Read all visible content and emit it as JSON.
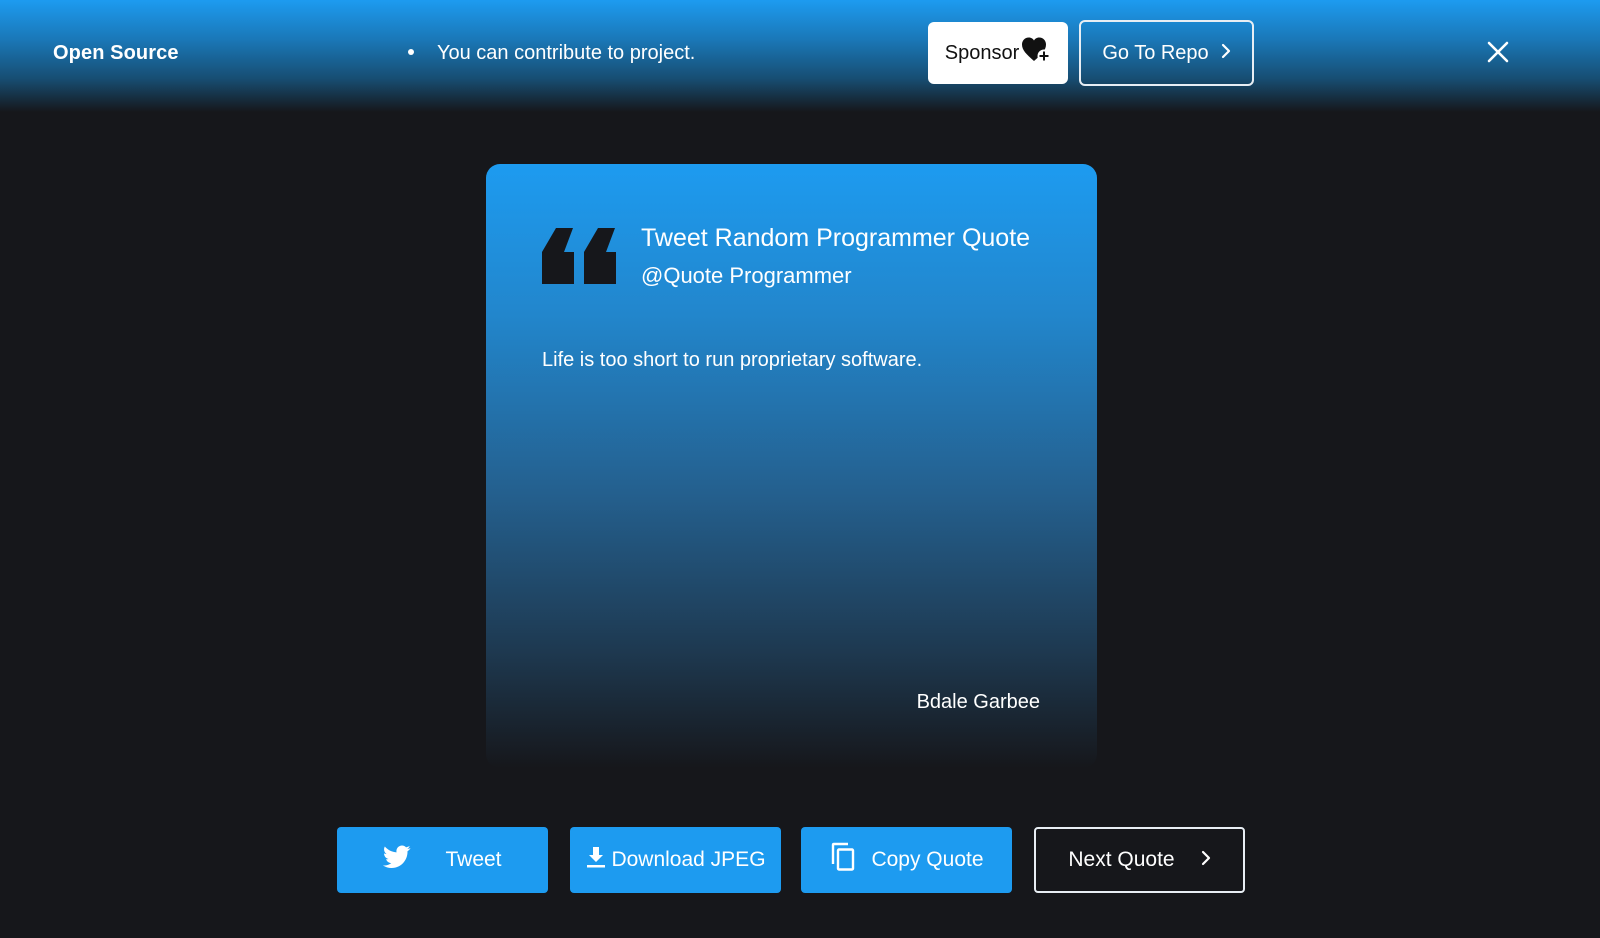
{
  "banner": {
    "title": "Open Source",
    "message": "You can contribute to project.",
    "sponsor_label": "Sponsor",
    "repo_label": "Go To Repo",
    "colors": {
      "accent": "#1d9bf0",
      "background": "#16171b"
    }
  },
  "card": {
    "title": "Tweet Random Programmer Quote",
    "handle": "@Quote Programmer",
    "quote": "Life is too short to run proprietary software.",
    "author": "Bdale Garbee"
  },
  "actions": {
    "tweet_label": "Tweet",
    "download_label": "Download JPEG",
    "copy_label": "Copy Quote",
    "next_label": "Next Quote"
  },
  "icons": {
    "sponsor": "heart-plus-icon",
    "repo": "chevron-right-icon",
    "close": "close-icon",
    "quote": "quote-mark-icon",
    "tweet": "twitter-bird-icon",
    "download": "download-icon",
    "copy": "copy-icon",
    "next": "chevron-right-icon"
  }
}
